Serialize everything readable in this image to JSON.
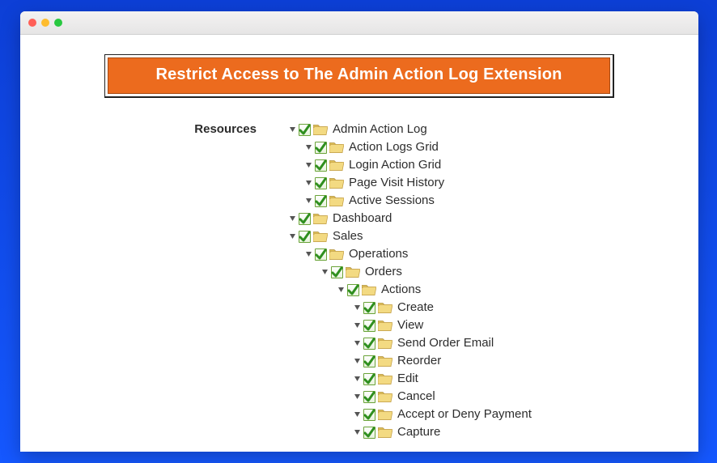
{
  "banner": {
    "title": "Restrict Access to The Admin Action Log Extension"
  },
  "form": {
    "label": "Resources"
  },
  "tree": [
    {
      "id": "admin-action-log",
      "label": "Admin Action Log",
      "checked": true,
      "children": [
        {
          "id": "action-logs-grid",
          "label": "Action Logs Grid",
          "checked": true
        },
        {
          "id": "login-action-grid",
          "label": "Login Action Grid",
          "checked": true
        },
        {
          "id": "page-visit-history",
          "label": "Page Visit History",
          "checked": true
        },
        {
          "id": "active-sessions",
          "label": "Active Sessions",
          "checked": true
        }
      ]
    },
    {
      "id": "dashboard",
      "label": "Dashboard",
      "checked": true
    },
    {
      "id": "sales",
      "label": "Sales",
      "checked": true,
      "children": [
        {
          "id": "operations",
          "label": "Operations",
          "checked": true,
          "children": [
            {
              "id": "orders",
              "label": "Orders",
              "checked": true,
              "children": [
                {
                  "id": "actions",
                  "label": "Actions",
                  "checked": true,
                  "children": [
                    {
                      "id": "create",
                      "label": "Create",
                      "checked": true
                    },
                    {
                      "id": "view",
                      "label": "View",
                      "checked": true
                    },
                    {
                      "id": "send-order-email",
                      "label": "Send Order Email",
                      "checked": true
                    },
                    {
                      "id": "reorder",
                      "label": "Reorder",
                      "checked": true
                    },
                    {
                      "id": "edit",
                      "label": "Edit",
                      "checked": true
                    },
                    {
                      "id": "cancel",
                      "label": "Cancel",
                      "checked": true
                    },
                    {
                      "id": "accept-or-deny-payment",
                      "label": "Accept or Deny Payment",
                      "checked": true
                    },
                    {
                      "id": "capture",
                      "label": "Capture",
                      "checked": true
                    }
                  ]
                }
              ]
            }
          ]
        }
      ]
    }
  ]
}
